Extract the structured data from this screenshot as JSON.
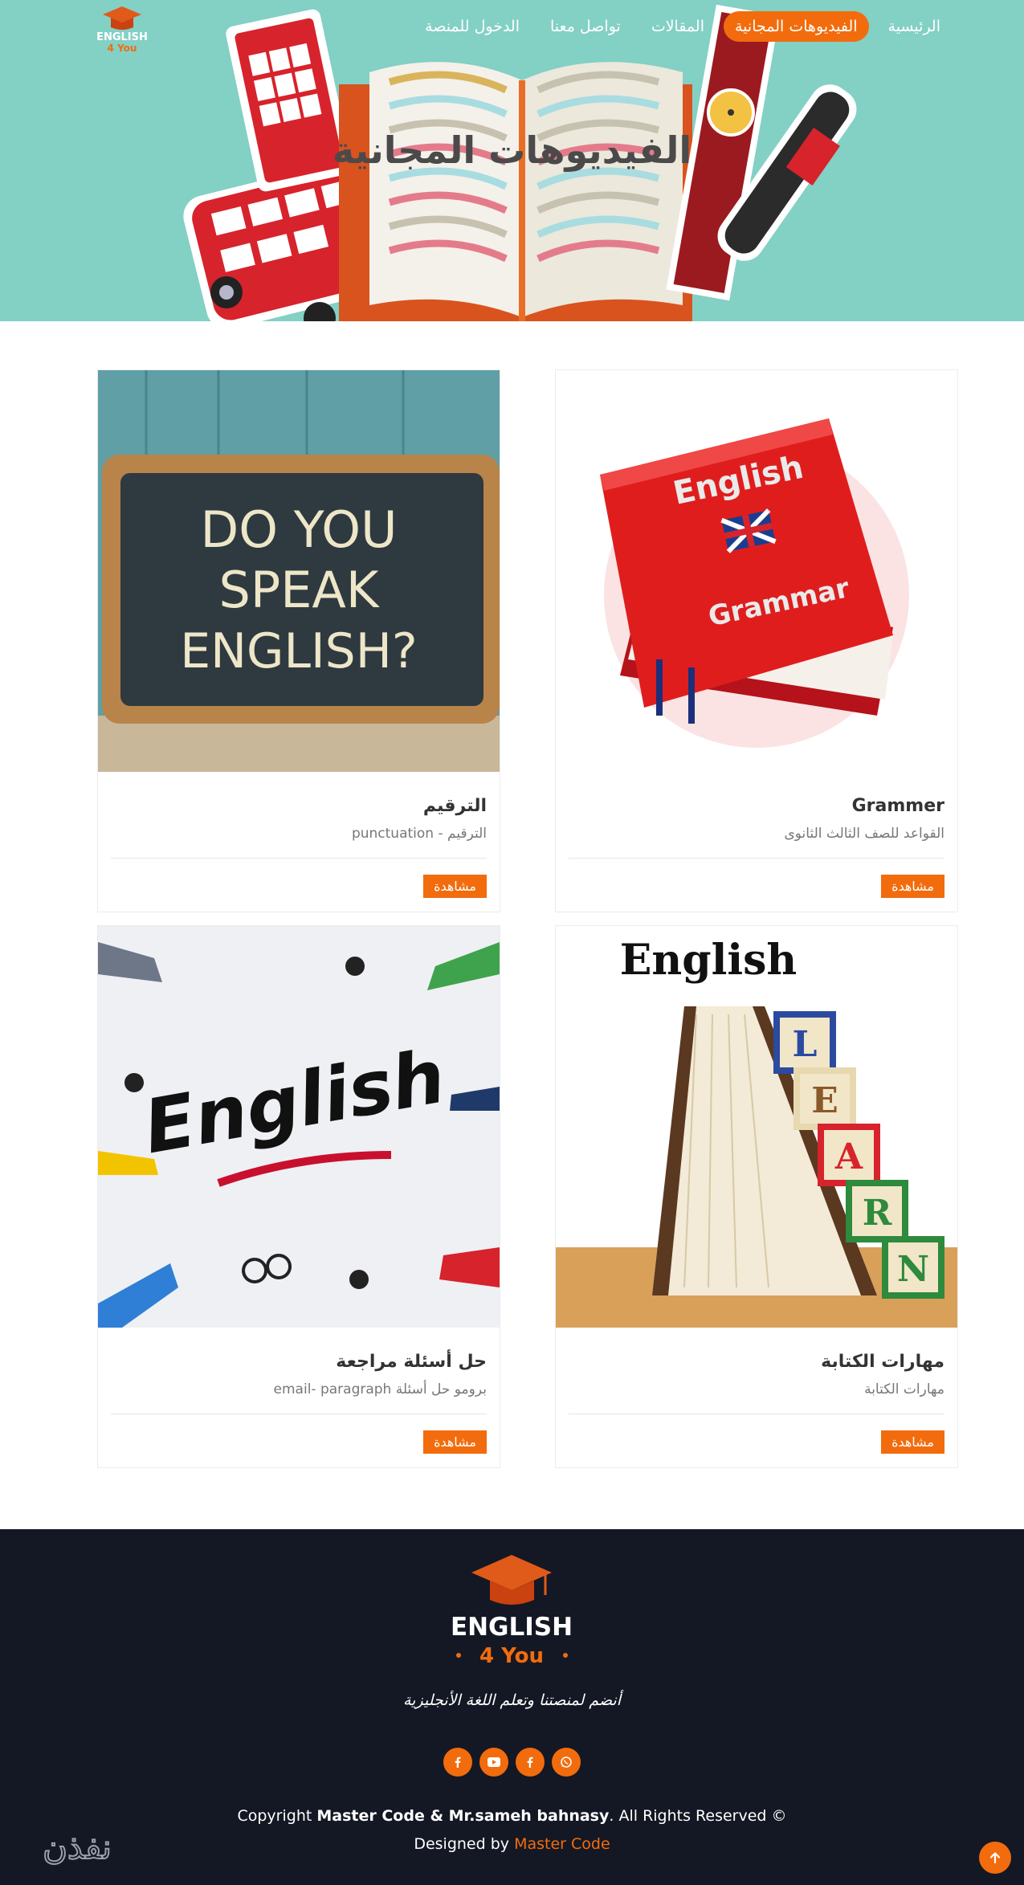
{
  "header": {
    "logo": {
      "line1": "ENGLISH",
      "line2": "4 You"
    },
    "nav": [
      {
        "label": "الرئيسية",
        "active": false
      },
      {
        "label": "الفيديوهات المجانية",
        "active": true
      },
      {
        "label": "المقالات",
        "active": false
      },
      {
        "label": "تواصل معنا",
        "active": false
      },
      {
        "label": "الدخول للمنصة",
        "active": false
      }
    ],
    "title": "الفيديوهات المجانية"
  },
  "cards": [
    {
      "title": "Grammer",
      "subtitle": "القواعد للصف الثالث الثانوى",
      "button": "مشاهدة",
      "image": "red-grammar-books",
      "image_text": {
        "line1": "English",
        "line2": "Grammar"
      }
    },
    {
      "title": "الترقيم",
      "subtitle": "الترقيم - punctuation",
      "button": "مشاهدة",
      "image": "chalkboard",
      "image_text": {
        "line1": "DO YOU",
        "line2": "SPEAK",
        "line3": "ENGLISH?"
      }
    },
    {
      "title": "مهارات الكتابة",
      "subtitle": "مهارات الكتابة",
      "button": "مشاهدة",
      "image": "book-and-blocks",
      "image_text": {
        "line1": "English",
        "blocks": [
          "L",
          "E",
          "A",
          "R",
          "N"
        ]
      }
    },
    {
      "title": "حل أسئلة مراجعة",
      "subtitle": "برومو حل أسئلة email- paragraph",
      "button": "مشاهدة",
      "image": "english-hands",
      "image_text": {
        "line1": "English"
      }
    }
  ],
  "footer": {
    "logo": {
      "line1": "ENGLISH",
      "line2": "4 You"
    },
    "tagline": "أنضم لمنصتنا وتعلم اللغة الأنجليزية",
    "socials": [
      "facebook-icon",
      "youtube-icon",
      "facebook-icon",
      "whatsapp-icon"
    ],
    "copyright_prefix": "Copyright",
    "copyright_owner": "Master Code & Mr.sameh bahnasy",
    "copyright_suffix": ". All Rights Reserved ©",
    "designed_prefix": "Designed by",
    "designed_link": "Master Code",
    "watermark": "نفذن"
  },
  "colors": {
    "accent": "#f26c0d",
    "hero_bg": "#83d0c5",
    "footer_bg": "#141824"
  }
}
